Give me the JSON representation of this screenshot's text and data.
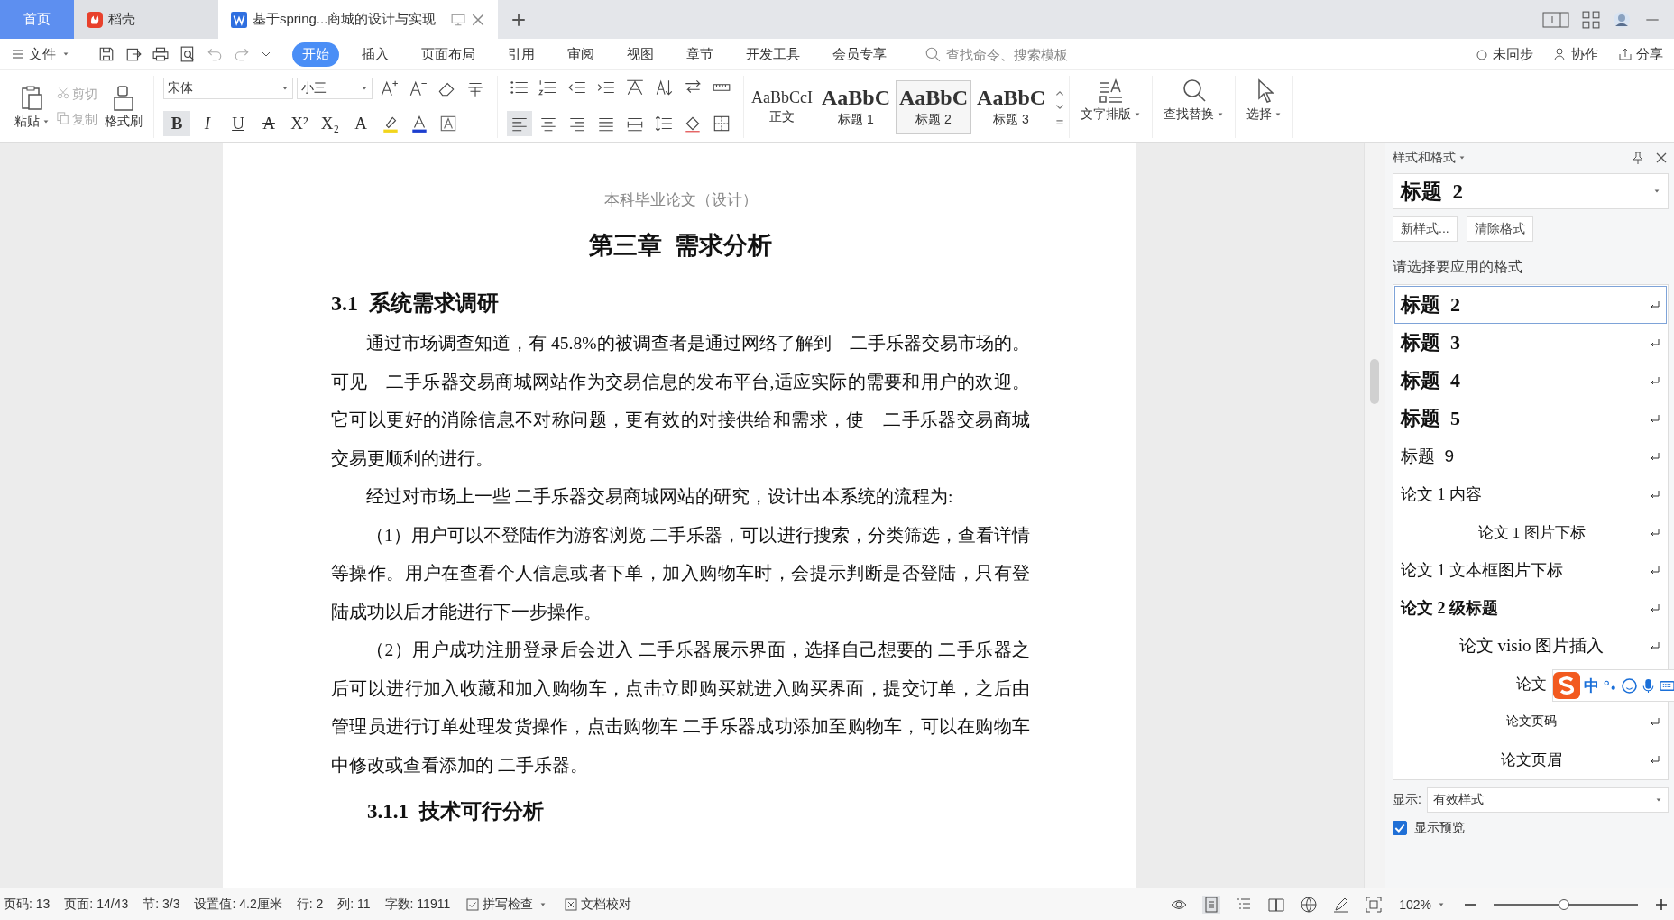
{
  "tabs": [
    {
      "label": "首页",
      "kind": "home",
      "selected": false
    },
    {
      "label": "稻壳",
      "kind": "app",
      "selected": false
    },
    {
      "label": "基于spring...商城的设计与实现",
      "kind": "doc",
      "selected": true
    }
  ],
  "menu": {
    "file": "文件",
    "ribbon_tabs": [
      {
        "label": "开始",
        "selected": true
      },
      {
        "label": "插入",
        "selected": false
      },
      {
        "label": "页面布局",
        "selected": false
      },
      {
        "label": "引用",
        "selected": false
      },
      {
        "label": "审阅",
        "selected": false
      },
      {
        "label": "视图",
        "selected": false
      },
      {
        "label": "章节",
        "selected": false
      },
      {
        "label": "开发工具",
        "selected": false
      },
      {
        "label": "会员专享",
        "selected": false
      }
    ],
    "search": {
      "placeholder": "查找命令、搜索模板"
    },
    "actions": [
      "未同步",
      "协作",
      "分享"
    ]
  },
  "ribbon": {
    "paste": "粘贴",
    "cut": "剪切",
    "copy": "复制",
    "format_painter": "格式刷",
    "font": "宋体",
    "size": "小三",
    "format_buttons": [
      {
        "glyph": "B",
        "active": true
      },
      {
        "glyph": "I",
        "active": false
      },
      {
        "glyph": "U",
        "active": false
      },
      {
        "glyph": "A",
        "active": false
      },
      {
        "glyph": "X²",
        "active": false
      },
      {
        "glyph": "X₂",
        "active": false
      },
      {
        "glyph": "A",
        "active": false
      }
    ],
    "align_buttons": [
      {
        "selected": true
      },
      {
        "selected": false
      },
      {
        "selected": false
      },
      {
        "selected": false
      },
      {
        "selected": false
      }
    ],
    "styles": [
      {
        "preview": "AaBbCcI",
        "label": "正文",
        "selected": false
      },
      {
        "preview": "AaBbC",
        "label": "标题 1",
        "selected": false
      },
      {
        "preview": "AaBbC",
        "label": "标题 2",
        "selected": true
      },
      {
        "preview": "AaBbC",
        "label": "标题 3",
        "selected": false
      }
    ],
    "big_buttons": [
      "文字排版",
      "查找替换",
      "选择"
    ]
  },
  "document": {
    "header": "本科毕业论文（设计）",
    "title": "第三章  需求分析",
    "blocks": [
      {
        "kind": "h2",
        "text": "3.1  系统需求调研"
      },
      {
        "kind": "p",
        "text": "通过市场调查知道，有 45.8%的被调查者是通过网络了解到　二手乐器交易市场的。可见　二手乐器交易商城网站作为交易信息的发布平台,适应实际的需要和用户的欢迎。它可以更好的消除信息不对称问题，更有效的对接供给和需求，使　二手乐器交易商城交易更顺利的进行。"
      },
      {
        "kind": "p",
        "text": "经过对市场上一些 二手乐器交易商城网站的研究，设计出本系统的流程为:"
      },
      {
        "kind": "p",
        "text": "（1）用户可以不登陆作为游客浏览 二手乐器，可以进行搜索，分类筛选，查看详情等操作。用户在查看个人信息或者下单，加入购物车时，会提示判断是否登陆，只有登陆成功以后才能进行下一步操作。"
      },
      {
        "kind": "p",
        "text": "（2）用户成功注册登录后会进入 二手乐器展示界面，选择自己想要的 二手乐器之后可以进行加入收藏和加入购物车，点击立即购买就进入购买界面，提交订单，之后由管理员进行订单处理发货操作，点击购物车 二手乐器成功添加至购物车，可以在购物车中修改或查看添加的 二手乐器。"
      },
      {
        "kind": "h3",
        "text": "3.1.1  技术可行分析"
      }
    ]
  },
  "panel": {
    "title": "样式和格式",
    "current": "标题  2",
    "buttons": [
      "新样式...",
      "清除格式"
    ],
    "prompt": "请选择要应用的格式",
    "styles": [
      {
        "label": "标题  2",
        "kind": "heading",
        "selected": true
      },
      {
        "label": "标题  3",
        "kind": "heading",
        "selected": false
      },
      {
        "label": "标题  4",
        "kind": "heading",
        "selected": false
      },
      {
        "label": "标题  5",
        "kind": "heading",
        "selected": false
      },
      {
        "label": "标题  9",
        "kind": "plain",
        "selected": false
      },
      {
        "label": "论文 1 内容",
        "kind": "serif",
        "selected": false
      },
      {
        "label": "论文 1 图片下标",
        "kind": "center",
        "selected": false
      },
      {
        "label": "论文 1 文本框图片下标",
        "kind": "serif",
        "selected": false
      },
      {
        "label": "论文 2 级标题",
        "kind": "bold",
        "selected": false
      },
      {
        "label": "论文 visio 图片插入",
        "kind": "center-large",
        "selected": false
      },
      {
        "label": "论文",
        "kind": "partial",
        "selected": false
      },
      {
        "label": "论文页码",
        "kind": "center-small",
        "selected": false
      },
      {
        "label": "论文页眉",
        "kind": "center",
        "selected": false
      }
    ],
    "show_label": "显示:",
    "show_value": "有效样式",
    "preview": {
      "label": "显示预览",
      "checked": true
    },
    "ime": {
      "label": "中"
    }
  },
  "status": {
    "items": [
      "页码: 13",
      "页面: 14/43",
      "节: 3/3",
      "设置值: 4.2厘米",
      "行: 2",
      "列: 11",
      "字数: 11911"
    ],
    "spell": "拼写检查",
    "proof": "文档校对",
    "zoom": "102%",
    "zoom_level": {
      "level": 0.49
    }
  }
}
